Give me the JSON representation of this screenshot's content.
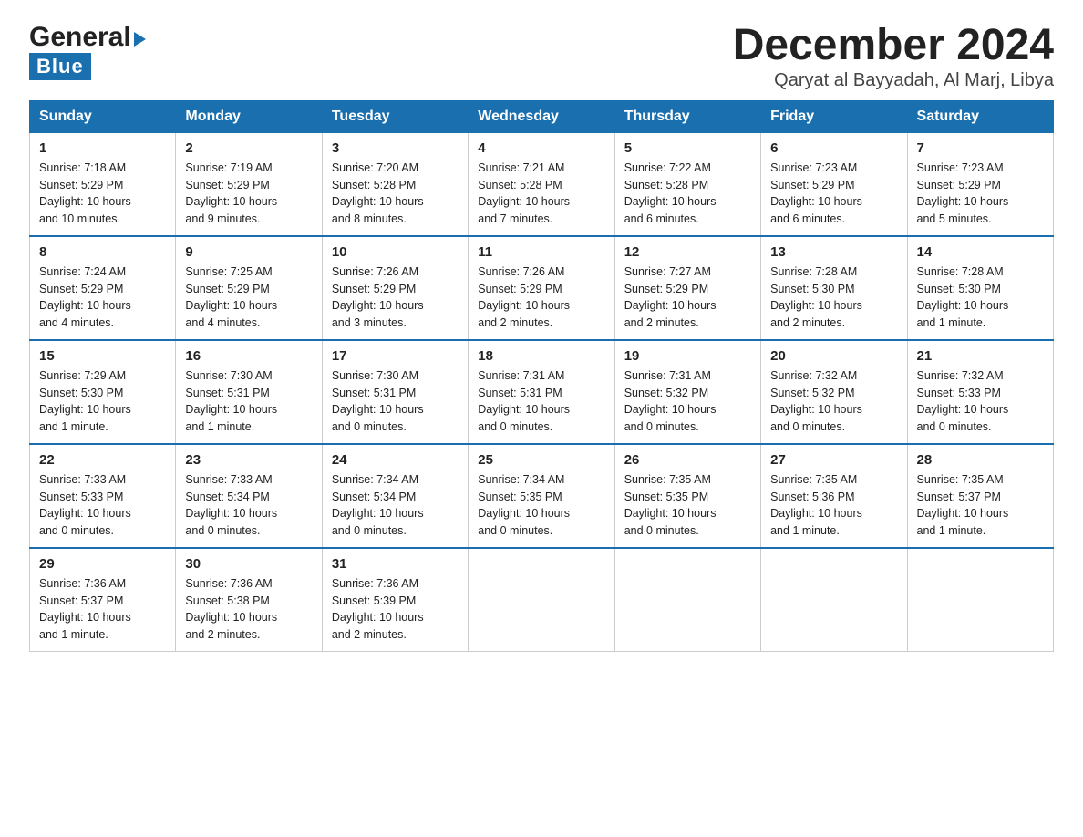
{
  "logo": {
    "general": "General",
    "blue": "Blue",
    "triangle": "▶"
  },
  "title": "December 2024",
  "subtitle": "Qaryat al Bayyadah, Al Marj, Libya",
  "weekdays": [
    "Sunday",
    "Monday",
    "Tuesday",
    "Wednesday",
    "Thursday",
    "Friday",
    "Saturday"
  ],
  "weeks": [
    [
      {
        "day": "1",
        "sunrise": "7:18 AM",
        "sunset": "5:29 PM",
        "daylight": "10 hours and 10 minutes."
      },
      {
        "day": "2",
        "sunrise": "7:19 AM",
        "sunset": "5:29 PM",
        "daylight": "10 hours and 9 minutes."
      },
      {
        "day": "3",
        "sunrise": "7:20 AM",
        "sunset": "5:28 PM",
        "daylight": "10 hours and 8 minutes."
      },
      {
        "day": "4",
        "sunrise": "7:21 AM",
        "sunset": "5:28 PM",
        "daylight": "10 hours and 7 minutes."
      },
      {
        "day": "5",
        "sunrise": "7:22 AM",
        "sunset": "5:28 PM",
        "daylight": "10 hours and 6 minutes."
      },
      {
        "day": "6",
        "sunrise": "7:23 AM",
        "sunset": "5:29 PM",
        "daylight": "10 hours and 6 minutes."
      },
      {
        "day": "7",
        "sunrise": "7:23 AM",
        "sunset": "5:29 PM",
        "daylight": "10 hours and 5 minutes."
      }
    ],
    [
      {
        "day": "8",
        "sunrise": "7:24 AM",
        "sunset": "5:29 PM",
        "daylight": "10 hours and 4 minutes."
      },
      {
        "day": "9",
        "sunrise": "7:25 AM",
        "sunset": "5:29 PM",
        "daylight": "10 hours and 4 minutes."
      },
      {
        "day": "10",
        "sunrise": "7:26 AM",
        "sunset": "5:29 PM",
        "daylight": "10 hours and 3 minutes."
      },
      {
        "day": "11",
        "sunrise": "7:26 AM",
        "sunset": "5:29 PM",
        "daylight": "10 hours and 2 minutes."
      },
      {
        "day": "12",
        "sunrise": "7:27 AM",
        "sunset": "5:29 PM",
        "daylight": "10 hours and 2 minutes."
      },
      {
        "day": "13",
        "sunrise": "7:28 AM",
        "sunset": "5:30 PM",
        "daylight": "10 hours and 2 minutes."
      },
      {
        "day": "14",
        "sunrise": "7:28 AM",
        "sunset": "5:30 PM",
        "daylight": "10 hours and 1 minute."
      }
    ],
    [
      {
        "day": "15",
        "sunrise": "7:29 AM",
        "sunset": "5:30 PM",
        "daylight": "10 hours and 1 minute."
      },
      {
        "day": "16",
        "sunrise": "7:30 AM",
        "sunset": "5:31 PM",
        "daylight": "10 hours and 1 minute."
      },
      {
        "day": "17",
        "sunrise": "7:30 AM",
        "sunset": "5:31 PM",
        "daylight": "10 hours and 0 minutes."
      },
      {
        "day": "18",
        "sunrise": "7:31 AM",
        "sunset": "5:31 PM",
        "daylight": "10 hours and 0 minutes."
      },
      {
        "day": "19",
        "sunrise": "7:31 AM",
        "sunset": "5:32 PM",
        "daylight": "10 hours and 0 minutes."
      },
      {
        "day": "20",
        "sunrise": "7:32 AM",
        "sunset": "5:32 PM",
        "daylight": "10 hours and 0 minutes."
      },
      {
        "day": "21",
        "sunrise": "7:32 AM",
        "sunset": "5:33 PM",
        "daylight": "10 hours and 0 minutes."
      }
    ],
    [
      {
        "day": "22",
        "sunrise": "7:33 AM",
        "sunset": "5:33 PM",
        "daylight": "10 hours and 0 minutes."
      },
      {
        "day": "23",
        "sunrise": "7:33 AM",
        "sunset": "5:34 PM",
        "daylight": "10 hours and 0 minutes."
      },
      {
        "day": "24",
        "sunrise": "7:34 AM",
        "sunset": "5:34 PM",
        "daylight": "10 hours and 0 minutes."
      },
      {
        "day": "25",
        "sunrise": "7:34 AM",
        "sunset": "5:35 PM",
        "daylight": "10 hours and 0 minutes."
      },
      {
        "day": "26",
        "sunrise": "7:35 AM",
        "sunset": "5:35 PM",
        "daylight": "10 hours and 0 minutes."
      },
      {
        "day": "27",
        "sunrise": "7:35 AM",
        "sunset": "5:36 PM",
        "daylight": "10 hours and 1 minute."
      },
      {
        "day": "28",
        "sunrise": "7:35 AM",
        "sunset": "5:37 PM",
        "daylight": "10 hours and 1 minute."
      }
    ],
    [
      {
        "day": "29",
        "sunrise": "7:36 AM",
        "sunset": "5:37 PM",
        "daylight": "10 hours and 1 minute."
      },
      {
        "day": "30",
        "sunrise": "7:36 AM",
        "sunset": "5:38 PM",
        "daylight": "10 hours and 2 minutes."
      },
      {
        "day": "31",
        "sunrise": "7:36 AM",
        "sunset": "5:39 PM",
        "daylight": "10 hours and 2 minutes."
      },
      null,
      null,
      null,
      null
    ]
  ],
  "labels": {
    "sunrise": "Sunrise:",
    "sunset": "Sunset:",
    "daylight": "Daylight:"
  }
}
